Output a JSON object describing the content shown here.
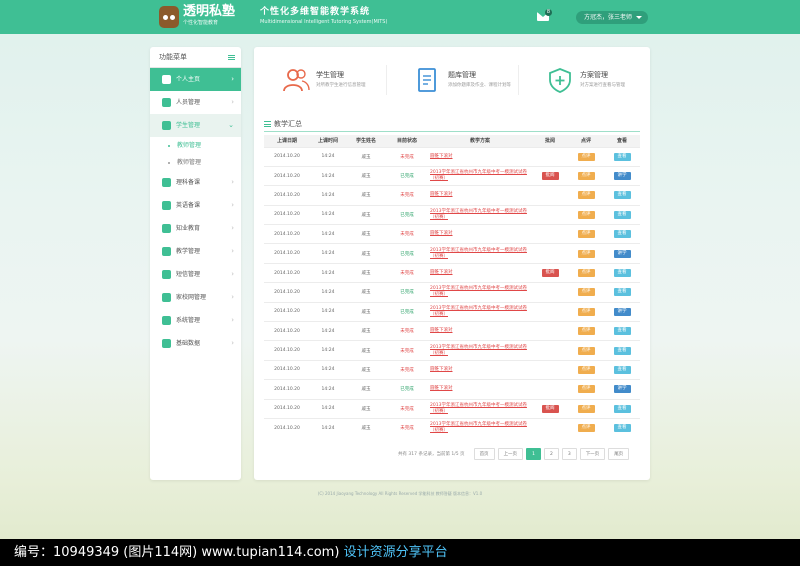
{
  "header": {
    "logo_title": "透明私塾",
    "logo_sub": "个性化智能教育",
    "system_title": "个性化多维智能教学系统",
    "system_sub": "Multidimensional Intelligent Tutoring System(MITS)",
    "mail_count": "8",
    "user_label": "方冠杰，张三老师"
  },
  "sidebar": {
    "title": "功能菜单",
    "items": [
      {
        "label": "个人主页",
        "state": "active"
      },
      {
        "label": "人员管理"
      },
      {
        "label": "学生管理",
        "state": "open"
      },
      {
        "label": "理科备课"
      },
      {
        "label": "英语备课"
      },
      {
        "label": "知业教育"
      },
      {
        "label": "教学管理"
      },
      {
        "label": "短信管理"
      },
      {
        "label": "家校网管理"
      },
      {
        "label": "系统管理"
      },
      {
        "label": "基础数据"
      }
    ],
    "sub_items": [
      {
        "label": "教师管理",
        "selected": true
      },
      {
        "label": "教师管理"
      }
    ]
  },
  "cards": [
    {
      "title": "学生管理",
      "desc": "对所教学生进行信息管理"
    },
    {
      "title": "题库管理",
      "desc": "添加你题库及作业、课程计划等"
    },
    {
      "title": "方案管理",
      "desc": "对方案进行查看与管理"
    }
  ],
  "section_title": "教学汇总",
  "table": {
    "headers": [
      "上课日期",
      "上课时间",
      "学生姓名",
      "目前状态",
      "教学方案",
      "批阅",
      "点评",
      "查看"
    ],
    "rows": [
      {
        "date": "2014.10.20",
        "time": "14:24",
        "student": "戚玉",
        "status": "未完成",
        "status_type": "red",
        "plan": "圆锥下滚对",
        "review": "",
        "comment": "点评",
        "view": "查看",
        "view_type": "blue"
      },
      {
        "date": "2014.10.20",
        "time": "14:24",
        "student": "戚玉",
        "status": "已完成",
        "status_type": "green",
        "plan": "2013学年浙江省杭州市九年级中考一模测试试卷（初赛）",
        "review": "批阅",
        "comment": "点评",
        "view": "讲学",
        "view_type": "navy"
      },
      {
        "date": "2014.10.20",
        "time": "14:24",
        "student": "戚玉",
        "status": "未完成",
        "status_type": "red",
        "plan": "圆锥下滚对",
        "review": "",
        "comment": "点评",
        "view": "查看",
        "view_type": "blue"
      },
      {
        "date": "2014.10.20",
        "time": "14:24",
        "student": "戚玉",
        "status": "已完成",
        "status_type": "green",
        "plan": "2013学年浙江省杭州市九年级中考一模测试试卷（初赛）",
        "review": "",
        "comment": "点评",
        "view": "查看",
        "view_type": "blue"
      },
      {
        "date": "2014.10.20",
        "time": "14:24",
        "student": "戚玉",
        "status": "未完成",
        "status_type": "red",
        "plan": "圆锥下滚对",
        "review": "",
        "comment": "点评",
        "view": "查看",
        "view_type": "blue"
      },
      {
        "date": "2014.10.20",
        "time": "14:24",
        "student": "戚玉",
        "status": "已完成",
        "status_type": "green",
        "plan": "2013学年浙江省杭州市九年级中考一模测试试卷（初赛）",
        "review": "",
        "comment": "点评",
        "view": "讲学",
        "view_type": "navy"
      },
      {
        "date": "2014.10.20",
        "time": "14:24",
        "student": "戚玉",
        "status": "未完成",
        "status_type": "red",
        "plan": "圆锥下滚对",
        "review": "批阅",
        "comment": "点评",
        "view": "查看",
        "view_type": "blue"
      },
      {
        "date": "2014.10.20",
        "time": "14:24",
        "student": "戚玉",
        "status": "已完成",
        "status_type": "green",
        "plan": "2013学年浙江省杭州市九年级中考一模测试试卷（初赛）",
        "review": "",
        "comment": "点评",
        "view": "查看",
        "view_type": "blue"
      },
      {
        "date": "2014.10.20",
        "time": "14:24",
        "student": "戚玉",
        "status": "已完成",
        "status_type": "green",
        "plan": "2013学年浙江省杭州市九年级中考一模测试试卷（初赛）",
        "review": "",
        "comment": "点评",
        "view": "讲学",
        "view_type": "navy"
      },
      {
        "date": "2014.10.20",
        "time": "14:24",
        "student": "戚玉",
        "status": "未完成",
        "status_type": "red",
        "plan": "圆锥下滚对",
        "review": "",
        "comment": "点评",
        "view": "查看",
        "view_type": "blue"
      },
      {
        "date": "2014.10.20",
        "time": "14:24",
        "student": "戚玉",
        "status": "未完成",
        "status_type": "red",
        "plan": "2013学年浙江省杭州市九年级中考一模测试试卷（初赛）",
        "review": "",
        "comment": "点评",
        "view": "查看",
        "view_type": "blue"
      },
      {
        "date": "2014.10.20",
        "time": "14:24",
        "student": "戚玉",
        "status": "未完成",
        "status_type": "red",
        "plan": "圆锥下滚对",
        "review": "",
        "comment": "点评",
        "view": "查看",
        "view_type": "blue"
      },
      {
        "date": "2014.10.20",
        "time": "14:24",
        "student": "戚玉",
        "status": "已完成",
        "status_type": "green",
        "plan": "圆锥下滚对",
        "review": "",
        "comment": "点评",
        "view": "讲学",
        "view_type": "navy"
      },
      {
        "date": "2014.10.20",
        "time": "14:24",
        "student": "戚玉",
        "status": "未完成",
        "status_type": "red",
        "plan": "2013学年浙江省杭州市九年级中考一模测试试卷（初赛）",
        "review": "批阅",
        "comment": "点评",
        "view": "查看",
        "view_type": "blue"
      },
      {
        "date": "2014.10.20",
        "time": "14:24",
        "student": "戚玉",
        "status": "未完成",
        "status_type": "red",
        "plan": "2013学年浙江省杭州市九年级中考一模测试试卷（初赛）",
        "review": "",
        "comment": "点评",
        "view": "查看",
        "view_type": "blue"
      }
    ]
  },
  "pager": {
    "info": "共有 317 条记录，当前第 1/5 页",
    "first": "首页",
    "prev": "上一页",
    "pages": [
      "1",
      "2",
      "3"
    ],
    "next": "下一页",
    "last": "尾页"
  },
  "footer": "(C) 2014 Jiaoyang Technology All Rights Reserved    学能科技  教师答疑    版本信息：V1.0",
  "watermark": {
    "text": "编号：10949349 (图片114网) www.tupian114.com)",
    "highlight": "设计资源分享平台"
  },
  "colors": {
    "accent": "#3fbf94",
    "danger": "#d9534f",
    "warning": "#f0ad4e",
    "info": "#5bc0de",
    "primary": "#428bca"
  }
}
